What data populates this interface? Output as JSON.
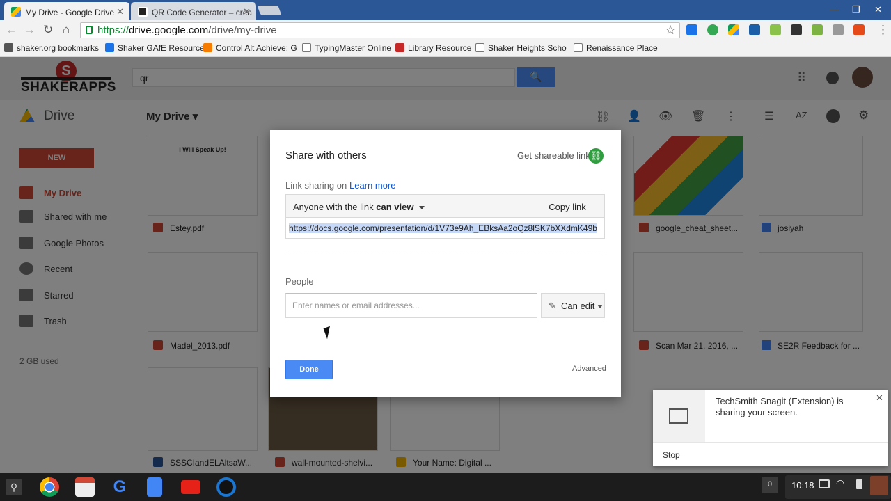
{
  "browser": {
    "tabs": [
      {
        "title": "My Drive - Google Drive",
        "active": true
      },
      {
        "title": "QR Code Generator – crea",
        "active": false
      }
    ],
    "url": {
      "scheme": "https://",
      "host": "drive.google.com",
      "path": "/drive/my-drive"
    },
    "bookmarks": [
      "shaker.org bookmarks",
      "Shaker GAfE Resource",
      "Control Alt Achieve: G",
      "TypingMaster Online",
      "Library Resource",
      "Shaker Heights Scho",
      "Renaissance Place"
    ],
    "icons": {
      "back": "back-arrow-icon",
      "forward": "forward-arrow-icon",
      "reload": "reload-icon",
      "home": "home-icon",
      "star": "star-icon",
      "menu": "menu-icon"
    }
  },
  "drive": {
    "logo_text": "SHAKERAPPS",
    "search_value": "qr",
    "app_name": "Drive",
    "location": "My Drive",
    "new_button": "NEW",
    "sidebar": [
      "My Drive",
      "Shared with me",
      "Google Photos",
      "Recent",
      "Starred",
      "Trash"
    ],
    "storage": "2 GB used",
    "files": [
      {
        "name": "Estey.pdf",
        "thumb_text": "I Will Speak Up!"
      },
      {
        "name": "google_cheat_sheet..."
      },
      {
        "name": "josiyah"
      },
      {
        "name": "Madel_2013.pdf"
      },
      {
        "name": "Scan Mar 21, 2016, ..."
      },
      {
        "name": "SE2R Feedback for ..."
      },
      {
        "name": "SSSCIandELAltsaW..."
      },
      {
        "name": "wall-mounted-shelvi..."
      },
      {
        "name": "Your Name: Digital ..."
      }
    ]
  },
  "dialog": {
    "title": "Share with others",
    "get_link": "Get shareable link",
    "link_sharing": "Link sharing on",
    "learn_more": "Learn more",
    "permission_prefix": "Anyone with the link",
    "permission_value": "can view",
    "copy_link": "Copy link",
    "url": "https://docs.google.com/presentation/d/1V73e9Ah_EBksAa2oQz8lSK7bXXdmK49b",
    "people_label": "People",
    "people_placeholder": "Enter names or email addresses...",
    "people_permission": "Can edit",
    "done": "Done",
    "advanced": "Advanced"
  },
  "notification": {
    "text": "TechSmith Snagit (Extension) is sharing your screen.",
    "stop": "Stop"
  },
  "shelf": {
    "notification_count": "0",
    "time": "10:18"
  }
}
